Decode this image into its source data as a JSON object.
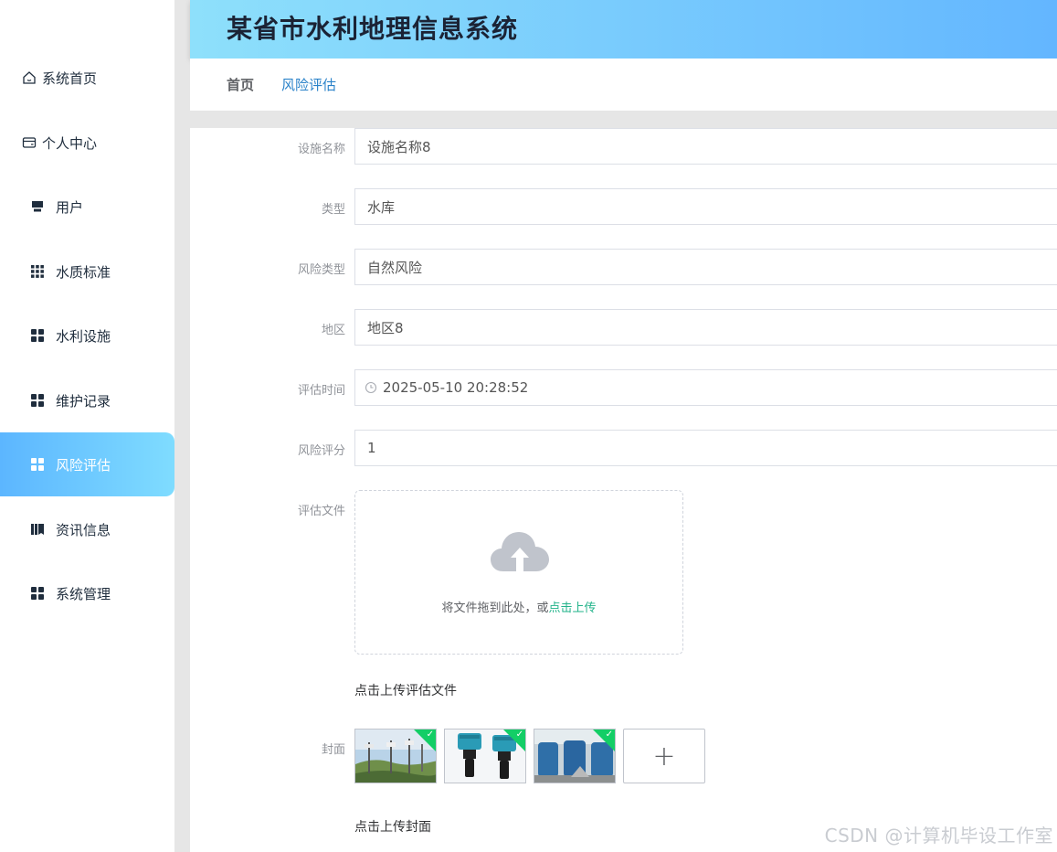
{
  "header": {
    "title": "某省市水利地理信息系统"
  },
  "breadcrumb": {
    "home": "首页",
    "current": "风险评估"
  },
  "sidebar": {
    "items": [
      {
        "label": "系统首页",
        "icon": "home-icon"
      },
      {
        "label": "个人中心",
        "icon": "wallet-icon"
      },
      {
        "label": "用户",
        "icon": "user-icon"
      },
      {
        "label": "水质标准",
        "icon": "grid-icon"
      },
      {
        "label": "水利设施",
        "icon": "apps-icon"
      },
      {
        "label": "维护记录",
        "icon": "apps-icon"
      },
      {
        "label": "风险评估",
        "icon": "apps-icon",
        "active": true
      },
      {
        "label": "资讯信息",
        "icon": "book-icon"
      },
      {
        "label": "系统管理",
        "icon": "apps-icon"
      }
    ],
    "active_color": "#5cb6ff"
  },
  "form": {
    "facility_name": {
      "label": "设施名称",
      "value": "设施名称8"
    },
    "type": {
      "label": "类型",
      "value": "水库"
    },
    "risk_type": {
      "label": "风险类型",
      "value": "自然风险"
    },
    "region": {
      "label": "地区",
      "value": "地区8"
    },
    "eval_time": {
      "label": "评估时间",
      "value": "2025-05-10 20:28:52"
    },
    "risk_score": {
      "label": "风险评分",
      "value": "1"
    },
    "eval_file": {
      "label": "评估文件",
      "upload_text": "将文件拖到此处，或",
      "upload_link": "点击上传",
      "tip": "点击上传评估文件"
    },
    "cover": {
      "label": "封面",
      "images": [
        "weather-station-photo",
        "water-meter-photo",
        "water-tank-photo"
      ],
      "add_symbol": "+",
      "tip": "点击上传封面"
    }
  },
  "watermark": "CSDN @计算机毕设工作室"
}
